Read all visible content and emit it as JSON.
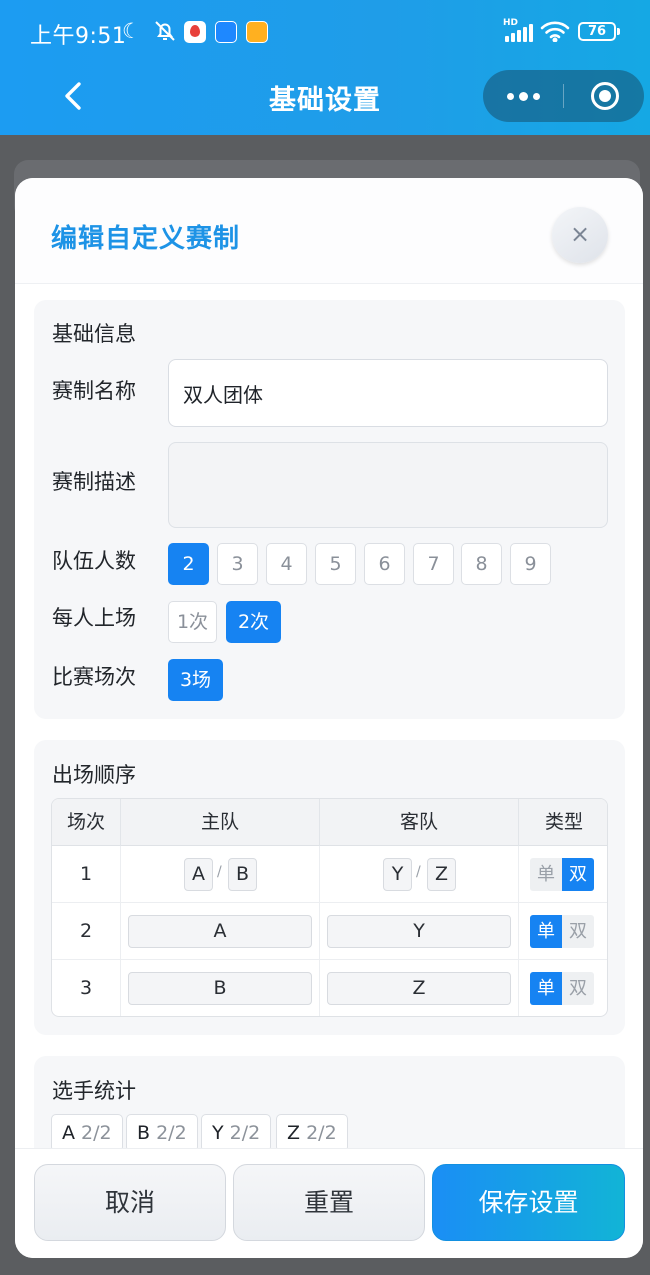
{
  "status_bar": {
    "time": "上午9:51",
    "hd": "HD",
    "battery": "76"
  },
  "nav": {
    "title": "基础设置"
  },
  "modal": {
    "title": "编辑自定义赛制",
    "close_glyph": "×",
    "basic": {
      "title": "基础信息",
      "name_label": "赛制名称",
      "name_value": "双人团体",
      "desc_label": "赛制描述",
      "desc_value": "",
      "team_size_label": "队伍人数",
      "team_size_options": [
        "2",
        "3",
        "4",
        "5",
        "6",
        "7",
        "8",
        "9"
      ],
      "team_size_selected": "2",
      "appearances_label": "每人上场",
      "appearances_options": [
        "1次",
        "2次"
      ],
      "appearances_selected": "2次",
      "matches_label": "比赛场次",
      "matches_options": [
        "3场"
      ],
      "matches_selected": "3场"
    },
    "order": {
      "title": "出场顺序",
      "headers": [
        "场次",
        "主队",
        "客队",
        "类型"
      ],
      "rows": [
        {
          "no": "1",
          "home": [
            "A",
            "B"
          ],
          "away": [
            "Y",
            "Z"
          ],
          "type_options": [
            "单",
            "双"
          ],
          "type": "双"
        },
        {
          "no": "2",
          "home": [
            "A"
          ],
          "away": [
            "Y"
          ],
          "type_options": [
            "单",
            "双"
          ],
          "type": "单"
        },
        {
          "no": "3",
          "home": [
            "B"
          ],
          "away": [
            "Z"
          ],
          "type_options": [
            "单",
            "双"
          ],
          "type": "单"
        }
      ],
      "pair_separator": "/"
    },
    "stats": {
      "title": "选手统计",
      "players": [
        {
          "name": "A",
          "count": "2/2"
        },
        {
          "name": "B",
          "count": "2/2"
        },
        {
          "name": "Y",
          "count": "2/2"
        },
        {
          "name": "Z",
          "count": "2/2"
        }
      ]
    },
    "footer": {
      "cancel": "取消",
      "reset": "重置",
      "save": "保存设置"
    }
  }
}
